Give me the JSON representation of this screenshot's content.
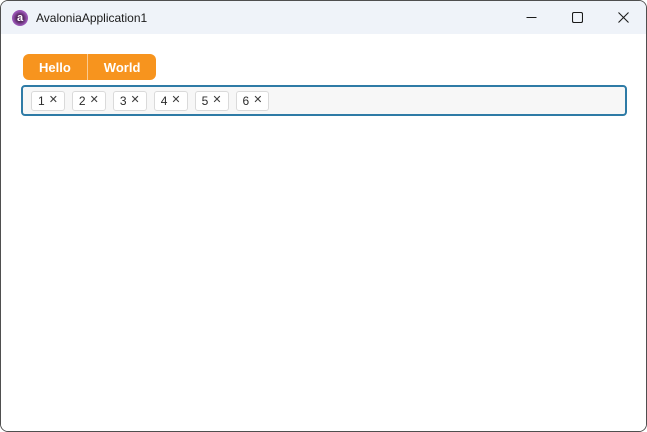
{
  "window": {
    "title": "AvaloniaApplication1",
    "logo_glyph": "a"
  },
  "buttons": [
    {
      "label": "Hello"
    },
    {
      "label": "World"
    }
  ],
  "tags": {
    "items": [
      "1",
      "2",
      "3",
      "4",
      "5",
      "6"
    ],
    "remove_glyph": "✕"
  },
  "colors": {
    "accent_orange": "#F7941E",
    "focus_border": "#2E7BA6",
    "titlebar_bg": "#EFF3F9",
    "window_border": "#4F4F4F",
    "logo_purple": "#8B3FA8",
    "tagsbox_bg": "#F7F7F7",
    "chip_border": "#DADADA",
    "text_dark": "#1B1B1B"
  }
}
